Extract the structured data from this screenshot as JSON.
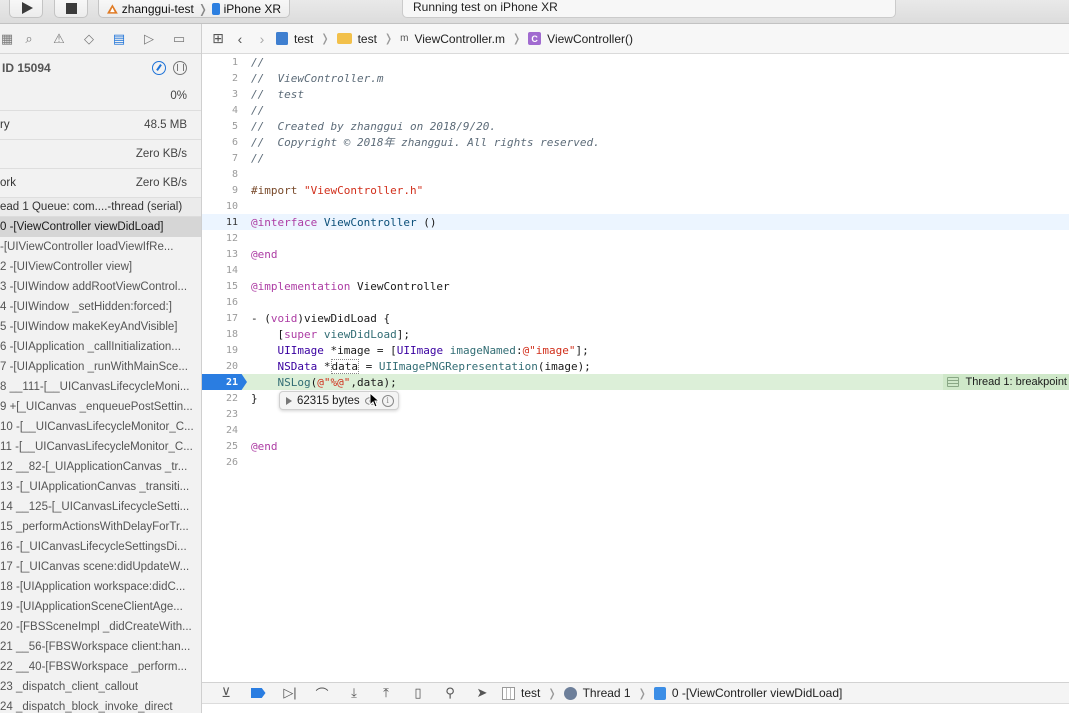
{
  "toolbar": {
    "scheme_name": "zhanggui-test",
    "device_name": "iPhone XR",
    "activity_status": "Running test on iPhone XR"
  },
  "navigator": {
    "pid_label": "ID 15094",
    "gauges": [
      {
        "label": "",
        "value": "0%"
      },
      {
        "label": "ry",
        "value": "48.5 MB"
      },
      {
        "label": "",
        "value": "Zero KB/s"
      },
      {
        "label": "ork",
        "value": "Zero KB/s"
      }
    ],
    "thread_label": "ead 1  Queue: com....-thread (serial)",
    "frames": [
      "0 -[ViewController viewDidLoad]",
      "  -[UIViewController loadViewIfRe...",
      "2 -[UIViewController view]",
      "3 -[UIWindow addRootViewControl...",
      "4 -[UIWindow _setHidden:forced:]",
      "5 -[UIWindow makeKeyAndVisible]",
      "6 -[UIApplication _callInitialization...",
      "7 -[UIApplication _runWithMainSce...",
      "8 __111-[__UICanvasLifecycleMoni...",
      "9 +[_UICanvas _enqueuePostSettin...",
      "10 -[__UICanvasLifecycleMonitor_C...",
      "11 -[__UICanvasLifecycleMonitor_C...",
      "12 __82-[_UIApplicationCanvas _tr...",
      "13 -[_UIApplicationCanvas _transiti...",
      "14 __125-[_UICanvasLifecycleSetti...",
      "15 _performActionsWithDelayForTr...",
      "16 -[_UICanvasLifecycleSettingsDi...",
      "17 -[_UICanvas scene:didUpdateW...",
      "18 -[UIApplication workspace:didC...",
      "19 -[UIApplicationSceneClientAge...",
      "20 -[FBSSceneImpl _didCreateWith...",
      "21 __56-[FBSWorkspace client:han...",
      "22 __40-[FBSWorkspace _perform...",
      "23 _dispatch_client_callout",
      "24 _dispatch_block_invoke_direct"
    ]
  },
  "jumpbar": {
    "crumbs": [
      "test",
      "test",
      "ViewController.m",
      "ViewController()"
    ]
  },
  "editor": {
    "breakpoint_label": "Thread 1: breakpoint",
    "datatip_value": "62315 bytes",
    "line_numbers": [
      "1",
      "2",
      "3",
      "4",
      "5",
      "6",
      "7",
      "8",
      "9",
      "10",
      "11",
      "12",
      "13",
      "14",
      "15",
      "16",
      "17",
      "18",
      "19",
      "20",
      "21",
      "22",
      "23",
      "24",
      "25",
      "26"
    ]
  },
  "debugbar": {
    "target": "test",
    "thread": "Thread 1",
    "frame": "0 -[ViewController viewDidLoad]"
  },
  "colors": {
    "accent": "#2a7de1",
    "breakpoint_line": "#dcefd8",
    "current_line": "#ecf5ff"
  }
}
